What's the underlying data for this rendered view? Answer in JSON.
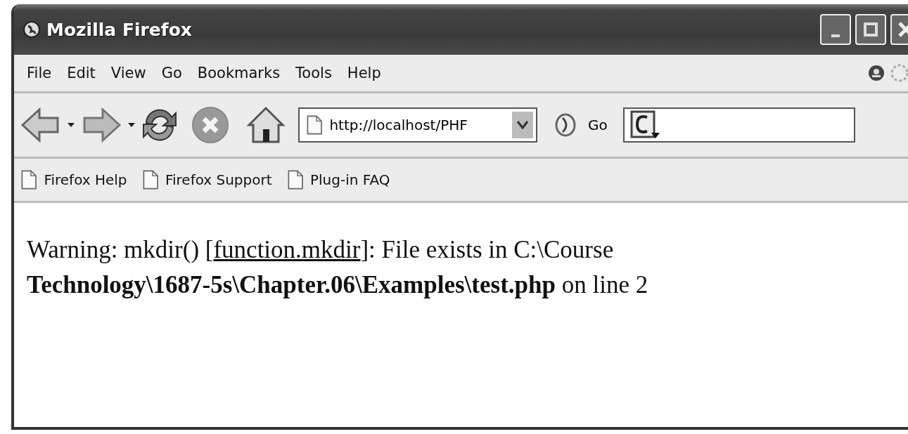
{
  "window": {
    "title": "Mozilla Firefox"
  },
  "menu": [
    "File",
    "Edit",
    "View",
    "Go",
    "Bookmarks",
    "Tools",
    "Help"
  ],
  "toolbar": {
    "url": "http://localhost/PHF",
    "go": "Go"
  },
  "bookmarks": [
    "Firefox Help",
    "Firefox Support",
    "Plug-in FAQ"
  ],
  "content": {
    "before": "Warning: mkdir() [",
    "link": "function.mkdir",
    "after": "]: File exists in C:\\Course **Technology\\1687-5s\\Chapter.06\\Examples\\test.php** on line 2"
  }
}
